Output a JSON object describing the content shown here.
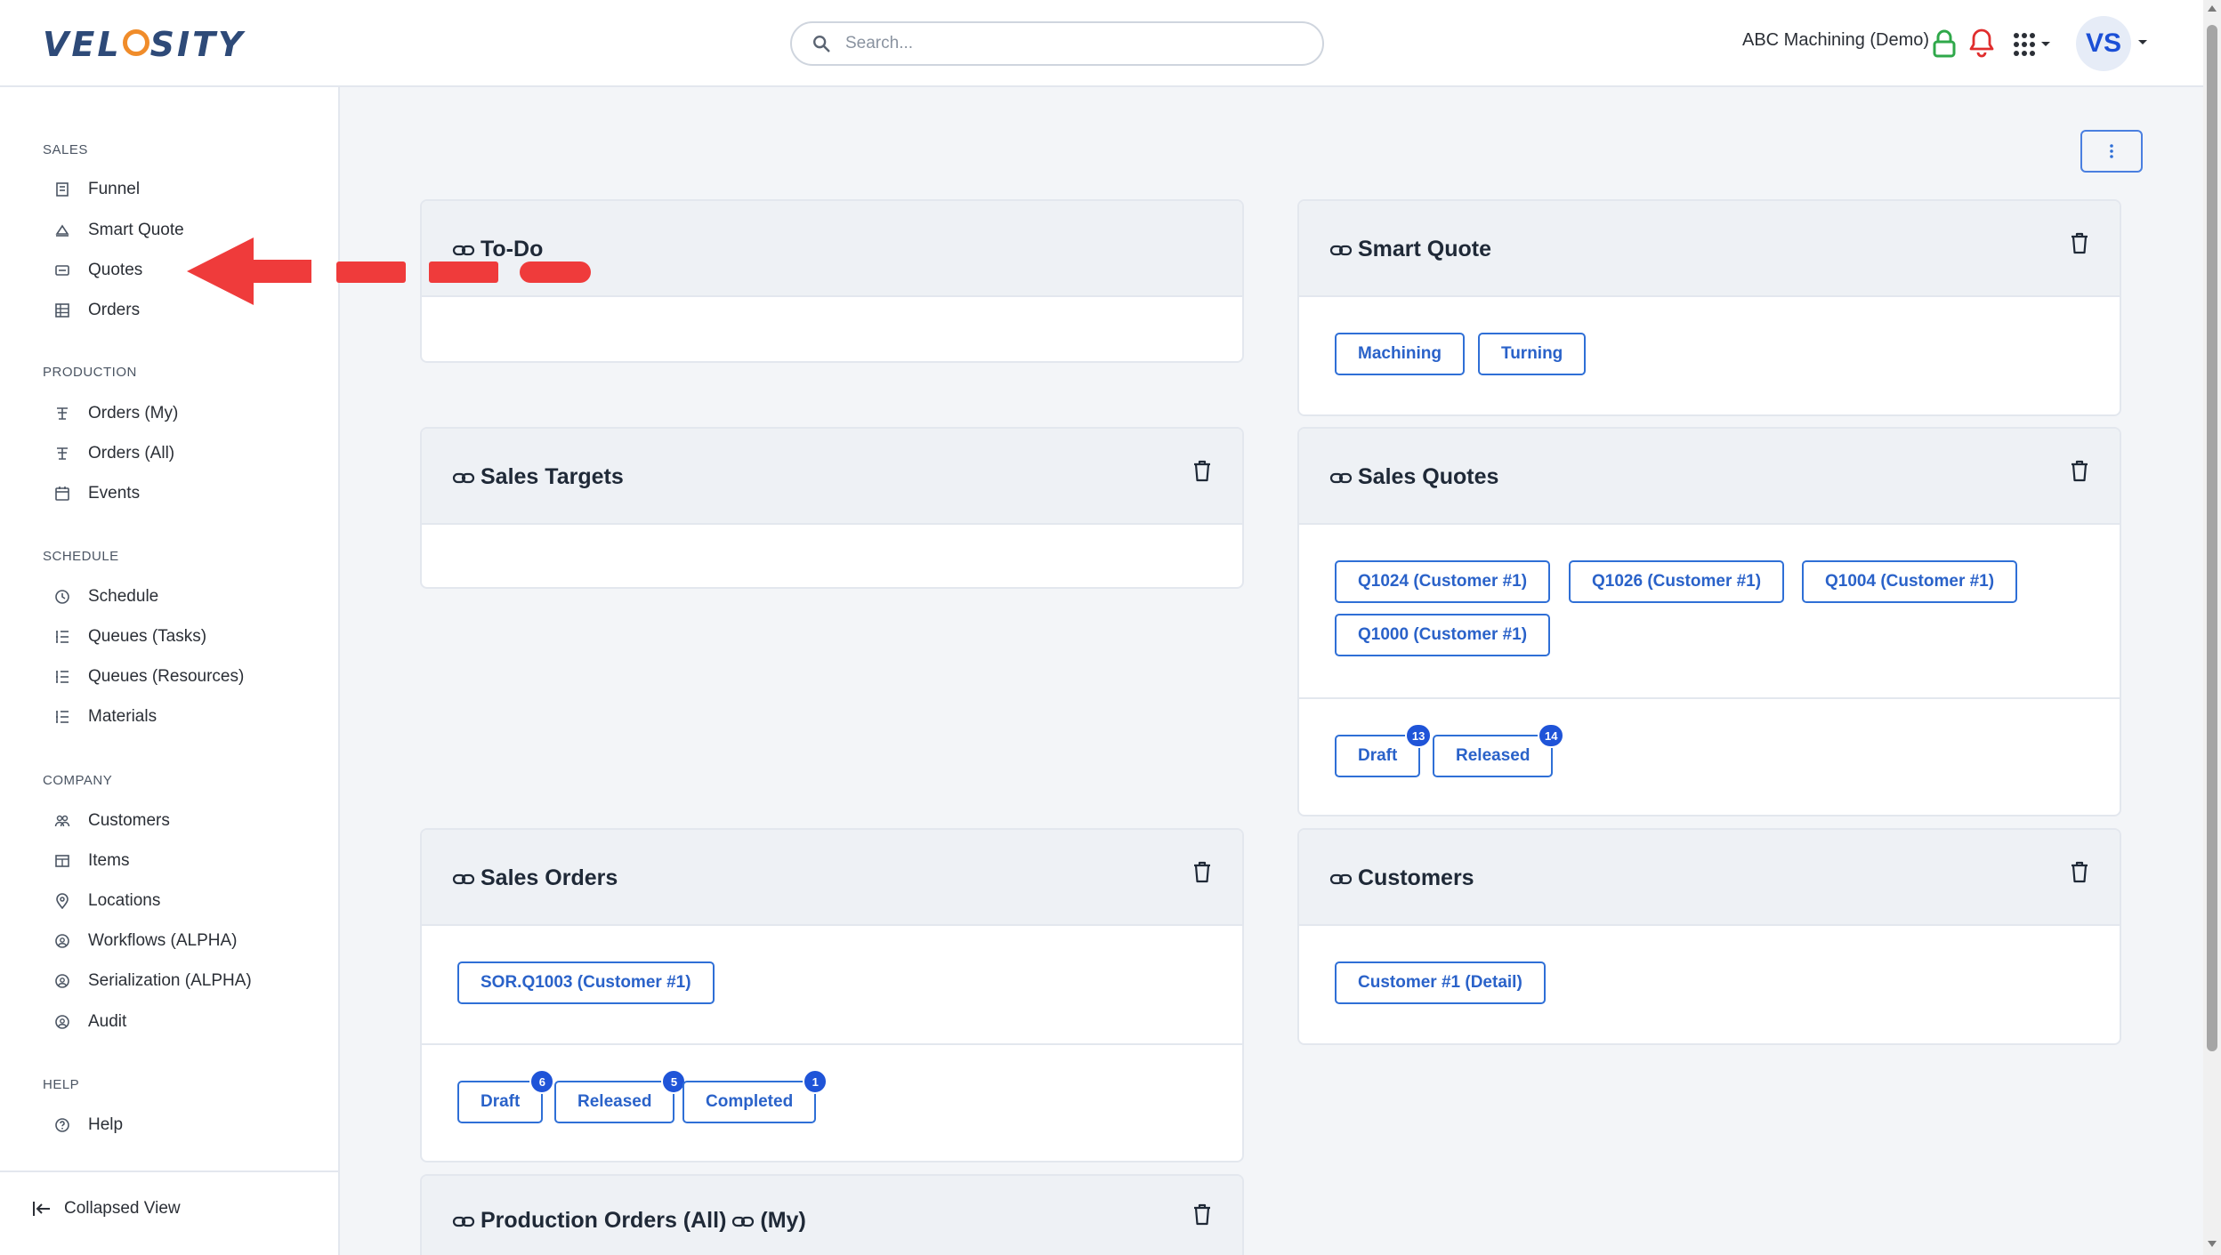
{
  "header": {
    "logo_text_left": "VEL",
    "logo_text_right": "SITY",
    "search_placeholder": "Search...",
    "company": "ABC Machining (Demo)",
    "avatar_initials": "VS"
  },
  "sidebar": {
    "sections": [
      {
        "title": "SALES",
        "items": [
          {
            "label": "Funnel",
            "icon": "funnel-icon"
          },
          {
            "label": "Smart Quote",
            "icon": "smart-quote-icon"
          },
          {
            "label": "Quotes",
            "icon": "quotes-icon"
          },
          {
            "label": "Orders",
            "icon": "orders-icon"
          }
        ]
      },
      {
        "title": "PRODUCTION",
        "items": [
          {
            "label": "Orders (My)",
            "icon": "production-icon"
          },
          {
            "label": "Orders (All)",
            "icon": "production-icon"
          },
          {
            "label": "Events",
            "icon": "calendar-icon"
          }
        ]
      },
      {
        "title": "SCHEDULE",
        "items": [
          {
            "label": "Schedule",
            "icon": "clock-icon"
          },
          {
            "label": "Queues (Tasks)",
            "icon": "list-icon"
          },
          {
            "label": "Queues (Resources)",
            "icon": "list-icon"
          },
          {
            "label": "Materials",
            "icon": "list-icon"
          }
        ]
      },
      {
        "title": "COMPANY",
        "items": [
          {
            "label": "Customers",
            "icon": "customers-icon"
          },
          {
            "label": "Items",
            "icon": "items-icon"
          },
          {
            "label": "Locations",
            "icon": "location-icon"
          },
          {
            "label": "Workflows (ALPHA)",
            "icon": "workflow-icon"
          },
          {
            "label": "Serialization (ALPHA)",
            "icon": "workflow-icon"
          },
          {
            "label": "Audit",
            "icon": "workflow-icon"
          }
        ]
      },
      {
        "title": "HELP",
        "items": [
          {
            "label": "Help",
            "icon": "help-icon"
          }
        ]
      }
    ],
    "collapsed_view": "Collapsed View"
  },
  "cards": {
    "todo": {
      "title": "To-Do"
    },
    "smart_quote": {
      "title": "Smart Quote",
      "buttons": [
        "Machining",
        "Turning"
      ]
    },
    "sales_targets": {
      "title": "Sales Targets"
    },
    "sales_quotes": {
      "title": "Sales Quotes",
      "quotes": [
        "Q1024 (Customer #1)",
        "Q1026 (Customer #1)",
        "Q1004 (Customer #1)",
        "Q1000 (Customer #1)"
      ],
      "statuses": [
        {
          "label": "Draft",
          "count": "13"
        },
        {
          "label": "Released",
          "count": "14"
        }
      ]
    },
    "sales_orders": {
      "title": "Sales Orders",
      "orders": [
        "SOR.Q1003 (Customer #1)"
      ],
      "statuses": [
        {
          "label": "Draft",
          "count": "6"
        },
        {
          "label": "Released",
          "count": "5"
        },
        {
          "label": "Completed",
          "count": "1"
        }
      ]
    },
    "customers": {
      "title": "Customers",
      "items": [
        "Customer #1 (Detail)"
      ]
    },
    "production_orders": {
      "title_all": "Production Orders (All)",
      "title_my": "(My)"
    }
  },
  "colors": {
    "accent": "#2f6fd6",
    "badge": "#1f54d8",
    "annotation_arrow": "#ef3b3b",
    "lock": "#2fa84a",
    "bell": "#e02d2d"
  }
}
